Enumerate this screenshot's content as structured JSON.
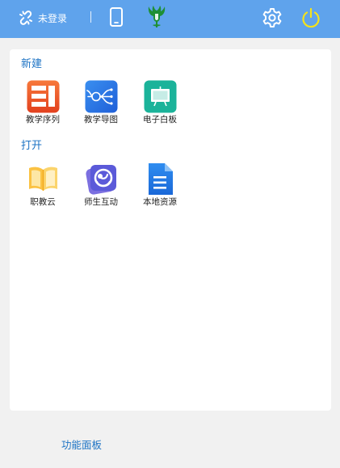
{
  "topbar": {
    "login_label": "未登录",
    "icons": [
      "link-icon",
      "phone-icon",
      "app-logo",
      "gear-icon",
      "power-icon"
    ]
  },
  "panel": {
    "new_section": {
      "title": "新建",
      "items": [
        {
          "label": "教学序列",
          "icon": "sequence-icon"
        },
        {
          "label": "教学导图",
          "icon": "mindmap-icon"
        },
        {
          "label": "电子白板",
          "icon": "whiteboard-icon"
        }
      ]
    },
    "open_section": {
      "title": "打开",
      "items": [
        {
          "label": "职教云",
          "icon": "book-icon"
        },
        {
          "label": "师生互动",
          "icon": "interaction-icon"
        },
        {
          "label": "本地资源",
          "icon": "document-icon"
        }
      ]
    }
  },
  "footer": {
    "link_label": "功能面板"
  },
  "colors": {
    "topbar": "#5fa3ec",
    "accent_text": "#1d73c4",
    "power_icon": "#f4e21a",
    "logo_green": "#1e8f35",
    "panel_bg": "#ffffff",
    "page_bg": "#f1f1f1"
  }
}
